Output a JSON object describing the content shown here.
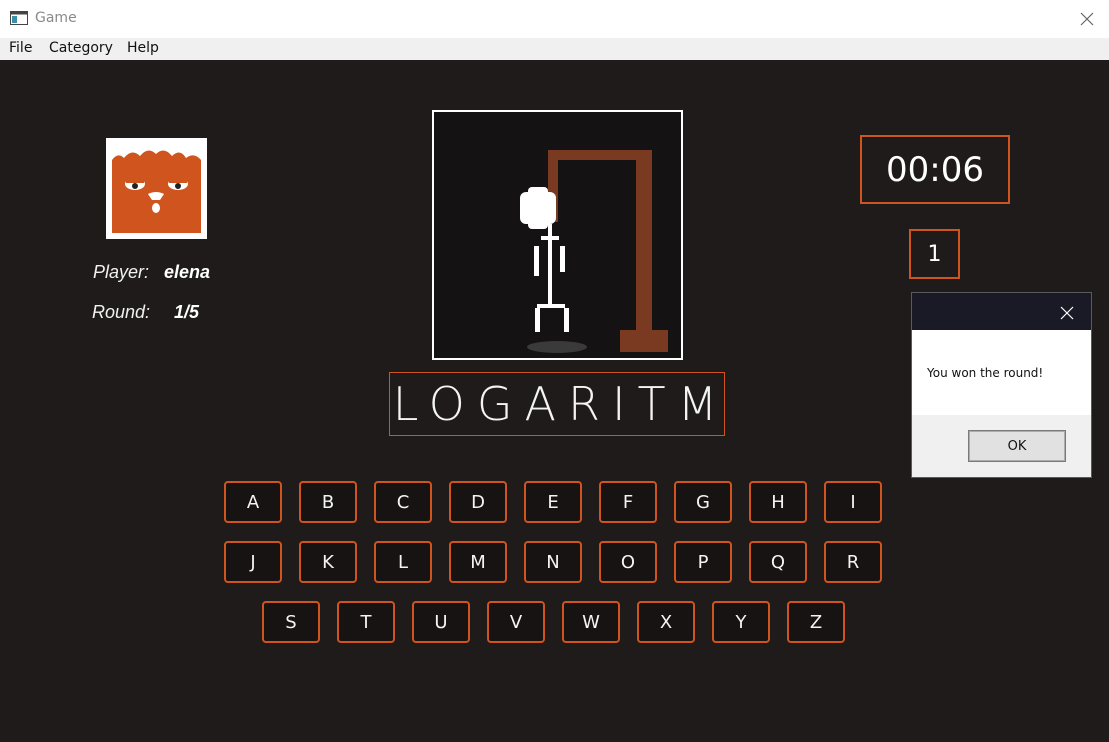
{
  "window": {
    "title": "Game"
  },
  "menu": [
    {
      "label": "File"
    },
    {
      "label": "Category"
    },
    {
      "label": "Help"
    }
  ],
  "player": {
    "label": "Player:",
    "name": "elena",
    "round_label": "Round:",
    "round_value": "1/5"
  },
  "word": {
    "text": "LOGARITM"
  },
  "timer": {
    "value": "00:06"
  },
  "wrong_count": {
    "value": "1"
  },
  "keyboard": {
    "rows": [
      [
        "A",
        "B",
        "C",
        "D",
        "E",
        "F",
        "G",
        "H",
        "I"
      ],
      [
        "J",
        "K",
        "L",
        "M",
        "N",
        "O",
        "P",
        "Q",
        "R"
      ],
      [
        "S",
        "T",
        "U",
        "V",
        "W",
        "X",
        "Y",
        "Z"
      ]
    ]
  },
  "dialog": {
    "message": "You won the round!",
    "ok_label": "OK"
  },
  "colors": {
    "accent": "#d0541e",
    "background": "#1e1b1a",
    "gallows": "#7a3a22"
  },
  "icons": {
    "app": "window-app-icon",
    "avatar": "cartoon-face-avatar",
    "close": "close-icon"
  }
}
